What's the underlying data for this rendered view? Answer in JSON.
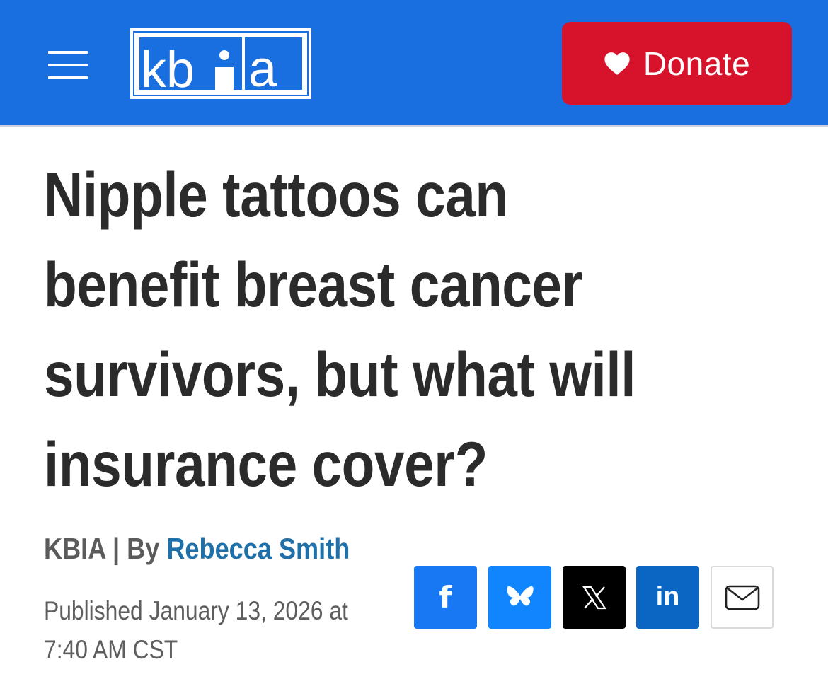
{
  "header": {
    "logo_text": "kbia",
    "donate_label": "Donate",
    "brand_color": "#1a6fe0",
    "donate_color": "#d7132b"
  },
  "article": {
    "title": "Nipple tattoos can benefit breast cancer survivors, but what will insurance cover?",
    "source": "KBIA",
    "separator": " | By ",
    "author": "Rebecca Smith",
    "published": "Published January 13, 2026 at 7:40 AM CST"
  },
  "share": {
    "facebook": "f",
    "linkedin": "in",
    "icons": [
      "facebook-icon",
      "bluesky-icon",
      "x-icon",
      "linkedin-icon",
      "email-icon"
    ]
  }
}
